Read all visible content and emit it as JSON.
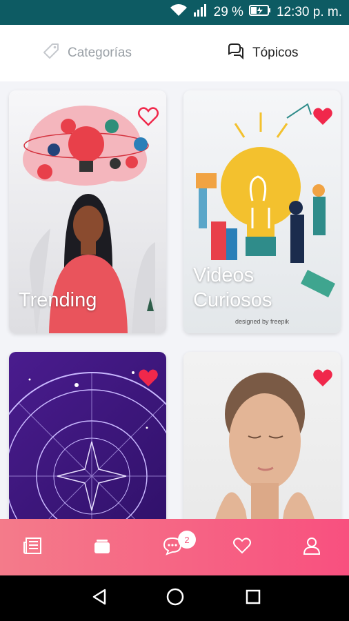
{
  "status_bar": {
    "battery": "29 %",
    "time": "12:30 p. m."
  },
  "tabs": [
    {
      "label": "Categorías",
      "active": false
    },
    {
      "label": "Tópicos",
      "active": true
    }
  ],
  "cards": [
    {
      "title": "Trending",
      "favorited": false
    },
    {
      "title": "Videos Curiosos",
      "title_line1": "Videos",
      "title_line2": "Curiosos",
      "favorited": true,
      "credit": "designed by freepik"
    },
    {
      "title": "",
      "favorited": true
    },
    {
      "title": "",
      "favorited": true
    }
  ],
  "bottom_nav": {
    "items": [
      "news-icon",
      "cards-icon",
      "chat-icon",
      "heart-icon",
      "profile-icon"
    ],
    "chat_badge": "2"
  },
  "colors": {
    "status_bar": "#0d5b63",
    "accent": "#f8507f",
    "heart": "#f0284b"
  }
}
